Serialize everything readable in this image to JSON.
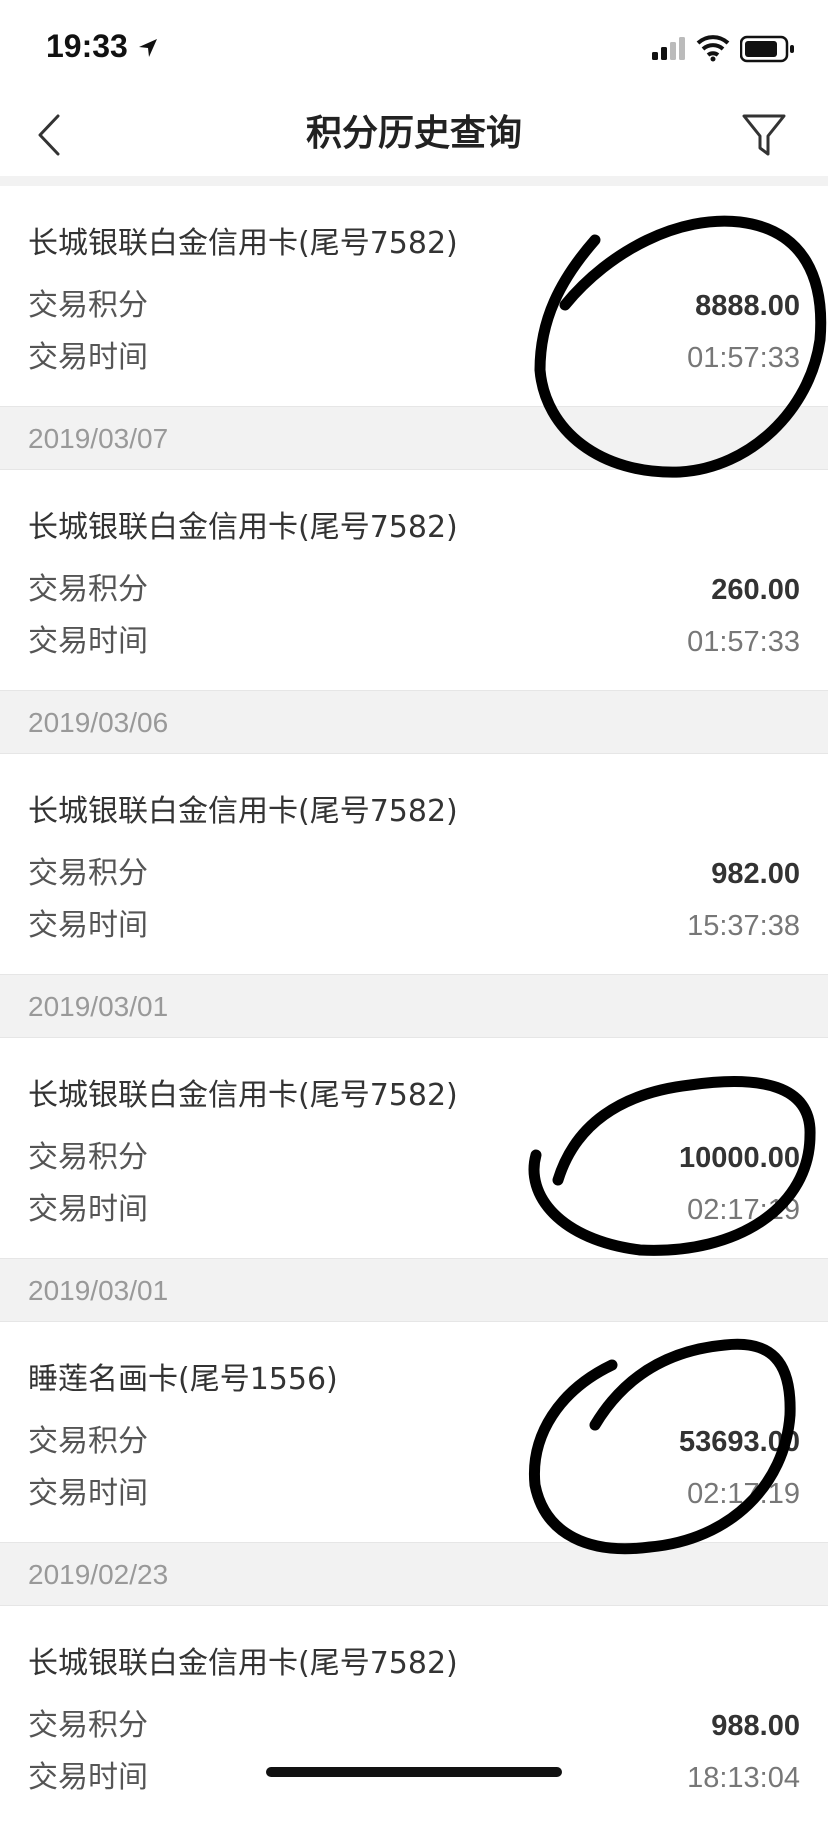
{
  "status_bar": {
    "time": "19:33"
  },
  "nav": {
    "title": "积分历史查询"
  },
  "records": [
    {
      "card": "长城银联白金信用卡(尾号7582)",
      "points_label": "交易积分",
      "points": "8888.00",
      "time_label": "交易时间",
      "time": "01:57:33"
    },
    {
      "date": "2019/03/07",
      "card": "长城银联白金信用卡(尾号7582)",
      "points_label": "交易积分",
      "points": "260.00",
      "time_label": "交易时间",
      "time": "01:57:33"
    },
    {
      "date": "2019/03/06",
      "card": "长城银联白金信用卡(尾号7582)",
      "points_label": "交易积分",
      "points": "982.00",
      "time_label": "交易时间",
      "time": "15:37:38"
    },
    {
      "date": "2019/03/01",
      "card": "长城银联白金信用卡(尾号7582)",
      "points_label": "交易积分",
      "points": "10000.00",
      "time_label": "交易时间",
      "time": "02:17:19"
    },
    {
      "date": "2019/03/01",
      "card": "睡莲名画卡(尾号1556)",
      "points_label": "交易积分",
      "points": "53693.00",
      "time_label": "交易时间",
      "time": "02:17:19"
    },
    {
      "date": "2019/02/23",
      "card": "长城银联白金信用卡(尾号7582)",
      "points_label": "交易积分",
      "points": "988.00",
      "time_label": "交易时间",
      "time": "18:13:04"
    }
  ],
  "icons": [
    "location-arrow-icon",
    "signal-icon",
    "wifi-icon",
    "battery-icon",
    "back-icon",
    "filter-icon"
  ]
}
